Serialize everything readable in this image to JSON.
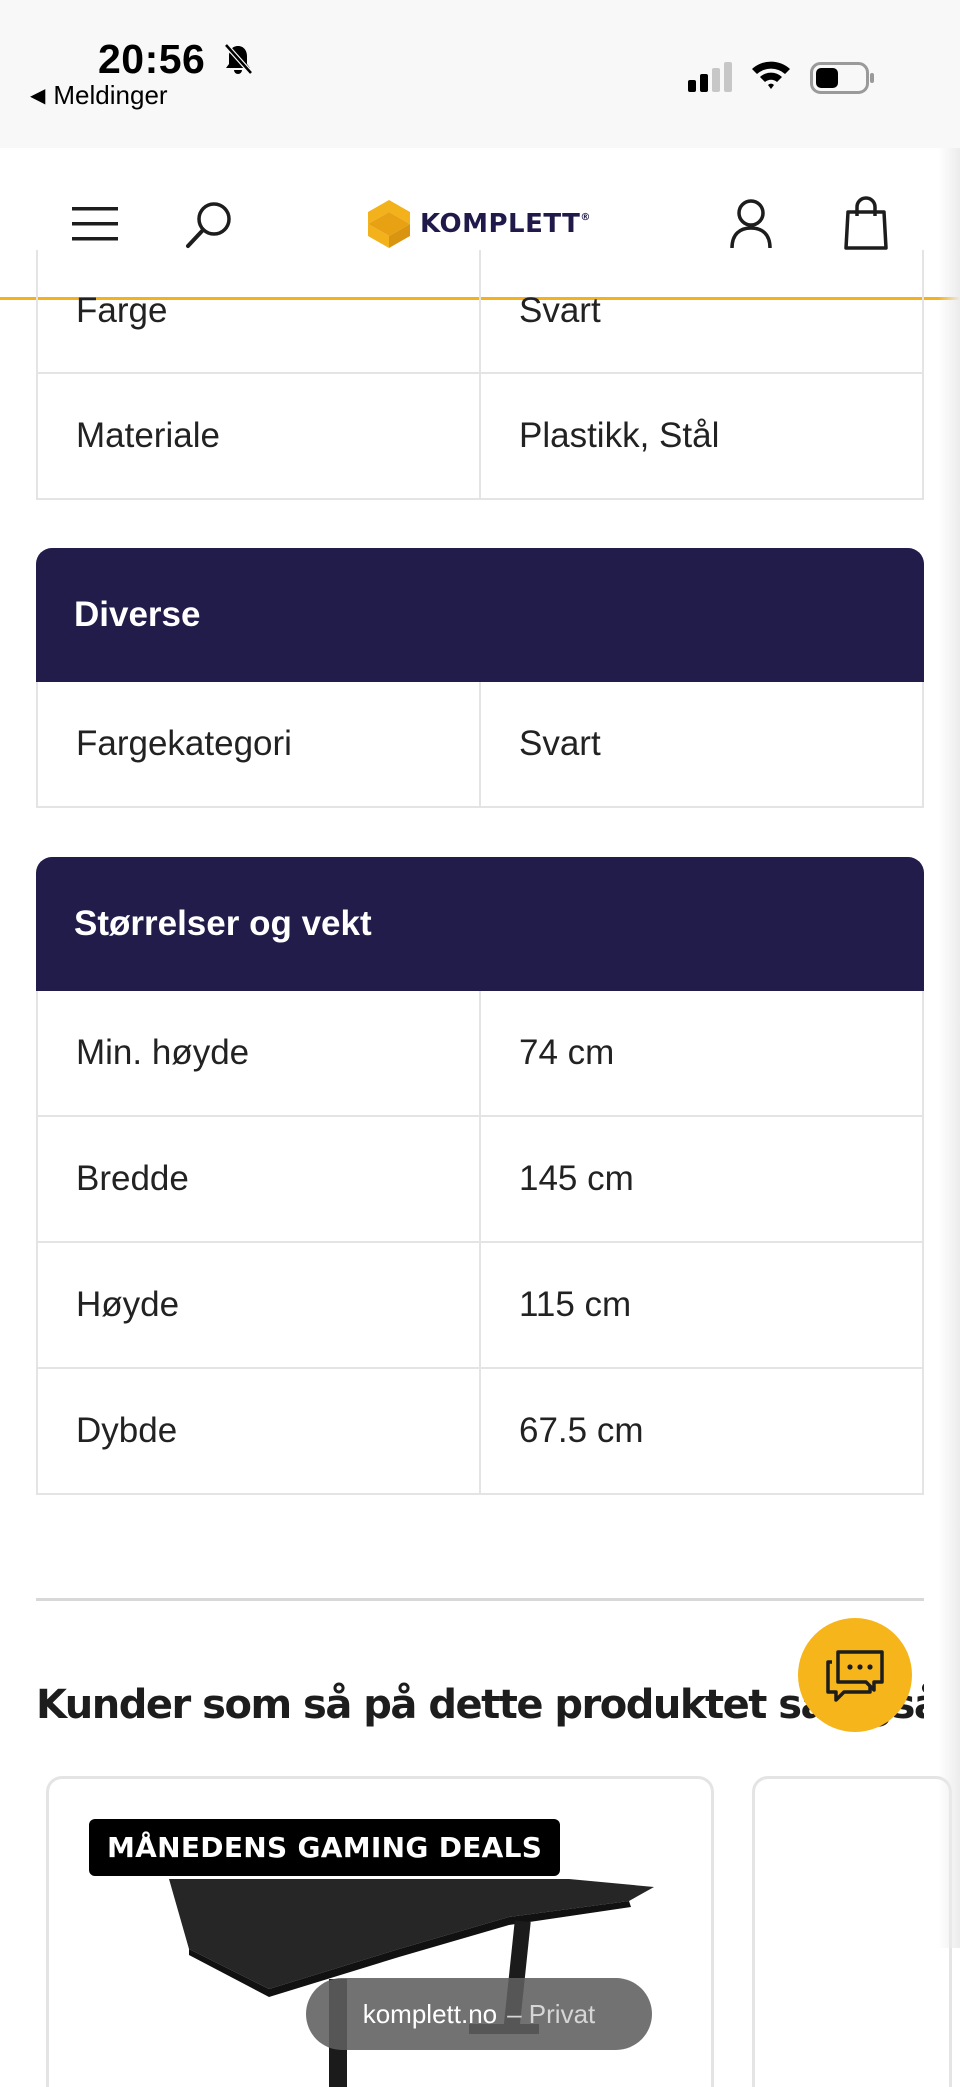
{
  "status_bar": {
    "time": "20:56",
    "back_app": "Meldinger"
  },
  "header": {
    "logo_text": "KOMPLETT",
    "logo_mark": "®",
    "brand_color": "#f3b21b",
    "icons": [
      "menu-icon",
      "search-icon",
      "user-icon",
      "cart-icon"
    ]
  },
  "specs": {
    "partial_rows": [
      {
        "label": "Farge",
        "value": "Svart"
      },
      {
        "label": "Materiale",
        "value": "Plastikk, Stål"
      }
    ],
    "diverse": {
      "title": "Diverse",
      "rows": [
        {
          "label": "Fargekategori",
          "value": "Svart"
        }
      ]
    },
    "sizes": {
      "title": "Størrelser og vekt",
      "rows": [
        {
          "label": "Min. høyde",
          "value": "74 cm"
        },
        {
          "label": "Bredde",
          "value": "145 cm"
        },
        {
          "label": "Høyde",
          "value": "115 cm"
        },
        {
          "label": "Dybde",
          "value": "67.5 cm"
        }
      ]
    },
    "header_color": "#211c4a"
  },
  "recommendations": {
    "title": "Kunder som så på dette produktet så også på",
    "cards": [
      {
        "badge": "MÅNEDENS GAMING DEALS"
      }
    ]
  },
  "chat": {
    "icon": "chat-icon",
    "color": "#f7b51c"
  },
  "browser": {
    "url": "komplett.no",
    "mode": "– Privat"
  }
}
